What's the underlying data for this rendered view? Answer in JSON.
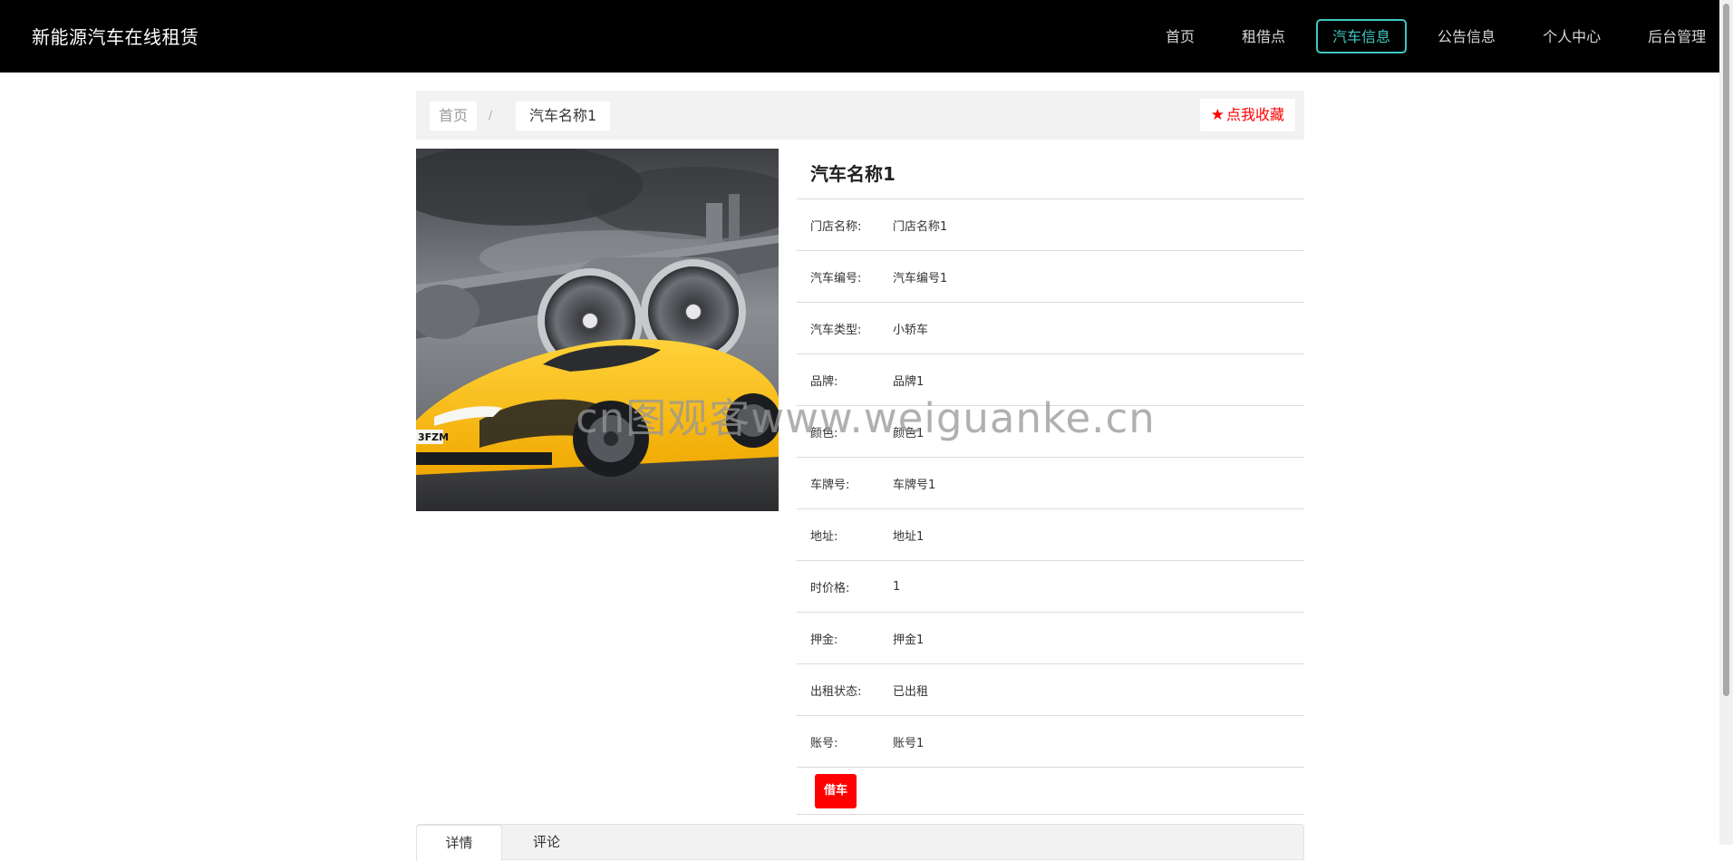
{
  "header": {
    "brand": "新能源汽车在线租赁",
    "nav": [
      {
        "label": "首页",
        "active": false
      },
      {
        "label": "租借点",
        "active": false
      },
      {
        "label": "汽车信息",
        "active": true
      },
      {
        "label": "公告信息",
        "active": false
      },
      {
        "label": "个人中心",
        "active": false
      },
      {
        "label": "后台管理",
        "active": false
      }
    ],
    "active_color": "#3fc7c2"
  },
  "breadcrumb": {
    "home": "首页",
    "separator": "/",
    "current": "汽车名称1"
  },
  "favorite": {
    "icon": "star-icon",
    "label": "点我收藏",
    "color": "#ff0000"
  },
  "car": {
    "image": "yellow-sports-car-photo",
    "title": "汽车名称1",
    "fields": [
      {
        "label": "门店名称:",
        "value": "门店名称1"
      },
      {
        "label": "汽车编号:",
        "value": "汽车编号1"
      },
      {
        "label": "汽车类型:",
        "value": "小轿车"
      },
      {
        "label": "品牌:",
        "value": "品牌1"
      },
      {
        "label": "颜色:",
        "value": "颜色1"
      },
      {
        "label": "车牌号:",
        "value": "车牌号1"
      },
      {
        "label": "地址:",
        "value": "地址1"
      },
      {
        "label": "时价格:",
        "value": "1"
      },
      {
        "label": "押金:",
        "value": "押金1"
      },
      {
        "label": "出租状态:",
        "value": "已出租"
      },
      {
        "label": "账号:",
        "value": "账号1"
      }
    ],
    "plate_text": "3FZM"
  },
  "borrow_button": {
    "label": "借车",
    "color": "#ff0000"
  },
  "tabs": [
    {
      "label": "详情",
      "active": true
    },
    {
      "label": "评论",
      "active": false
    }
  ],
  "watermark": "cn图观客www.weiguanke.cn"
}
